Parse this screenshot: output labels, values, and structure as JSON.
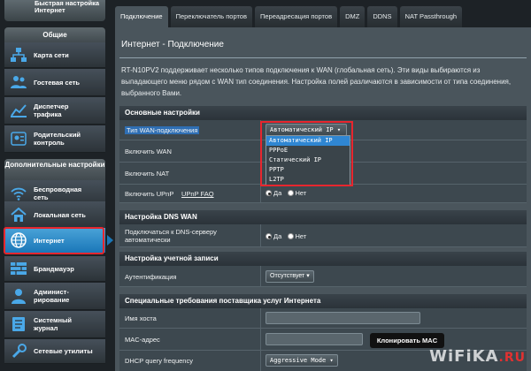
{
  "sidebar": {
    "quick_setup_label": "Быстрая настройка Интернет",
    "general_section": "Общие",
    "general_items": [
      {
        "label": "Карта сети",
        "icon": "network-map-icon"
      },
      {
        "label": "Гостевая сеть",
        "icon": "guest-network-icon"
      },
      {
        "label": "Диспетчер трафика",
        "icon": "traffic-manager-icon"
      },
      {
        "label": "Родительский контроль",
        "icon": "parental-control-icon"
      }
    ],
    "advanced_section": "Дополнительные настройки",
    "advanced_items": [
      {
        "label": "Беспроводная сеть",
        "icon": "wireless-icon"
      },
      {
        "label": "Локальная сеть",
        "icon": "lan-home-icon"
      },
      {
        "label": "Интернет",
        "icon": "internet-globe-icon",
        "active": true
      },
      {
        "label": "Брандмауэр",
        "icon": "firewall-icon"
      },
      {
        "label": "Админист-рирование",
        "icon": "administration-icon"
      },
      {
        "label": "Системный журнал",
        "icon": "system-log-icon"
      },
      {
        "label": "Сетевые утилиты",
        "icon": "network-tools-icon"
      }
    ]
  },
  "tabs": [
    {
      "label": "Подключение",
      "active": true
    },
    {
      "label": "Переключатель портов"
    },
    {
      "label": "Переадресация портов"
    },
    {
      "label": "DMZ"
    },
    {
      "label": "DDNS"
    },
    {
      "label": "NAT Passthrough"
    }
  ],
  "page": {
    "title": "Интернет - Подключение",
    "description": "RT-N10PV2 поддерживает несколько типов подключения к WAN (глобальная сеть). Эти виды выбираются из выпадающего меню рядом с WAN тип соединения. Настройка полей различаются в зависимости от типа соединения, выбранного Вами."
  },
  "basic": {
    "header": "Основные настройки",
    "wan_type_label": "Тип WAN-подключения",
    "wan_type_value": "Автоматический IP",
    "wan_options": [
      "Автоматический IP",
      "PPPoE",
      "Статический IP",
      "PPTP",
      "L2TP"
    ],
    "enable_wan_label": "Включить WAN",
    "enable_nat_label": "Включить NAT",
    "enable_upnp_label": "Включить UPnP",
    "upnp_faq": "UPnP FAQ",
    "yes": "Да",
    "no": "Нет"
  },
  "dns": {
    "header": "Настройка DNS WAN",
    "auto_dns_label": "Подключаться к DNS-серверу автоматически",
    "yes": "Да",
    "no": "Нет"
  },
  "account": {
    "header": "Настройка учетной записи",
    "auth_label": "Аутентификация",
    "auth_value": "Отсутствует"
  },
  "isp": {
    "header": "Специальные требования поставщика услуг Интернета",
    "hostname_label": "Имя хоста",
    "mac_label": "MAC-адрес",
    "clone_mac_button": "Клонировать MAC",
    "dhcp_freq_label": "DHCP query frequency",
    "dhcp_freq_value": "Aggressive Mode"
  },
  "watermark": {
    "brand": "WiFiKA",
    "suffix": ".RU"
  },
  "colors": {
    "accent": "#1a77b8",
    "highlight": "#e8262e",
    "panel": "#4a555c"
  }
}
